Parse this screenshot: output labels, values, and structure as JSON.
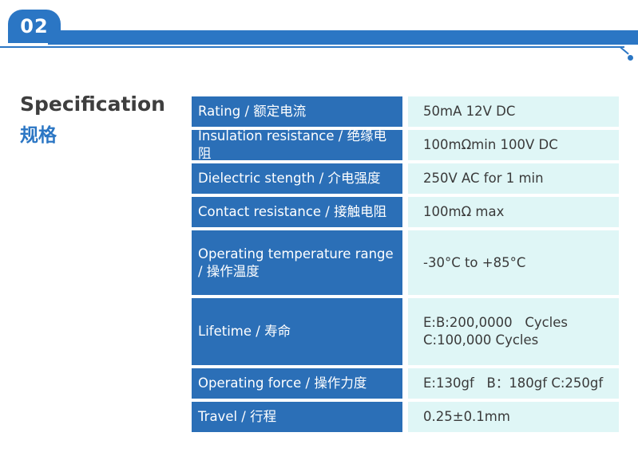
{
  "header": {
    "badge": "02"
  },
  "title": {
    "en": "Specification",
    "cn": "规格"
  },
  "specs": [
    {
      "label": "Rating / 额定电流",
      "value": [
        "50mA 12V DC"
      ]
    },
    {
      "label": "Insulation resistance / 绝缘电阻",
      "value": [
        "100mΩmin 100V DC"
      ]
    },
    {
      "label": "Dielectric stength / 介电强度",
      "value": [
        "250V AC for 1 min"
      ]
    },
    {
      "label": "Contact resistance / 接触电阻",
      "value": [
        "100mΩ max"
      ]
    },
    {
      "label": [
        "Operating temperature range",
        "/ 操作温度"
      ],
      "value": [
        "-30°C to +85°C"
      ]
    },
    {
      "label": "Lifetime / 寿命",
      "value": [
        "E:B:200,0000   Cycles",
        "C:100,000 Cycles"
      ]
    },
    {
      "label": "Operating force / 操作力度",
      "value": [
        "E:130gf   B：180gf C:250gf"
      ]
    },
    {
      "label": "Travel / 行程",
      "value": [
        "0.25±0.1mm"
      ]
    }
  ]
}
